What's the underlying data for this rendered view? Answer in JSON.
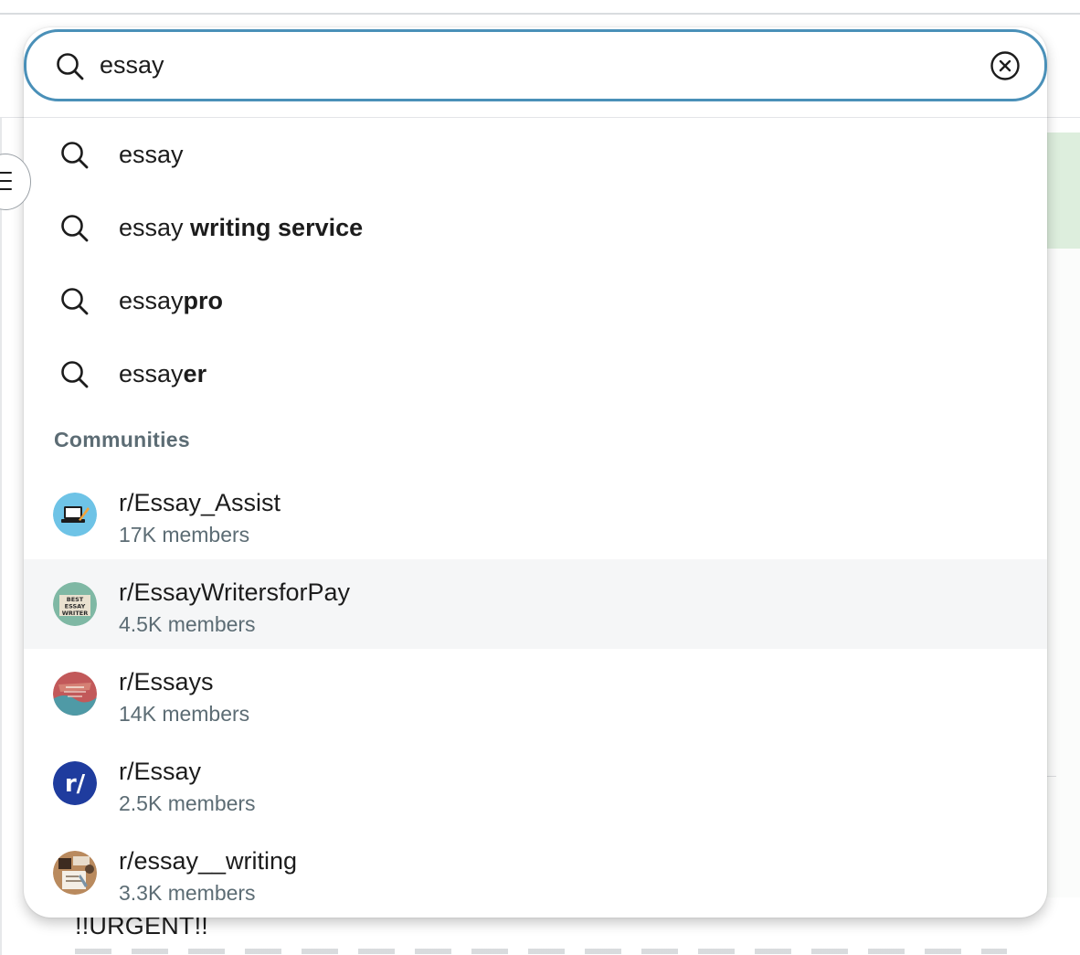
{
  "search": {
    "value": "essay",
    "icon": "search-icon",
    "clear_icon": "clear-icon"
  },
  "suggestions": [
    {
      "prefix": "essay",
      "suffix": ""
    },
    {
      "prefix": "essay ",
      "suffix": "writing service"
    },
    {
      "prefix": "essay",
      "suffix": "pro"
    },
    {
      "prefix": "essay",
      "suffix": "er"
    }
  ],
  "communities_heading": "Communities",
  "communities": [
    {
      "name": "r/Essay_Assist",
      "members": "17K members"
    },
    {
      "name": "r/EssayWritersforPay",
      "members": "4.5K members",
      "avatar_text": [
        "BEST",
        "ESSAY",
        "WRITER"
      ]
    },
    {
      "name": "r/Essays",
      "members": "14K members"
    },
    {
      "name": "r/Essay",
      "members": "2.5K members",
      "avatar_text": "r/"
    },
    {
      "name": "r/essay__writing",
      "members": "3.3K members"
    }
  ],
  "background": {
    "post_title": "!!URGENT!!"
  },
  "colors": {
    "focus_border": "#4a90b8",
    "hover_row": "#f5f6f7",
    "secondary_text": "#5c6c74",
    "reddit_default_avatar": "#1f3c9e"
  }
}
